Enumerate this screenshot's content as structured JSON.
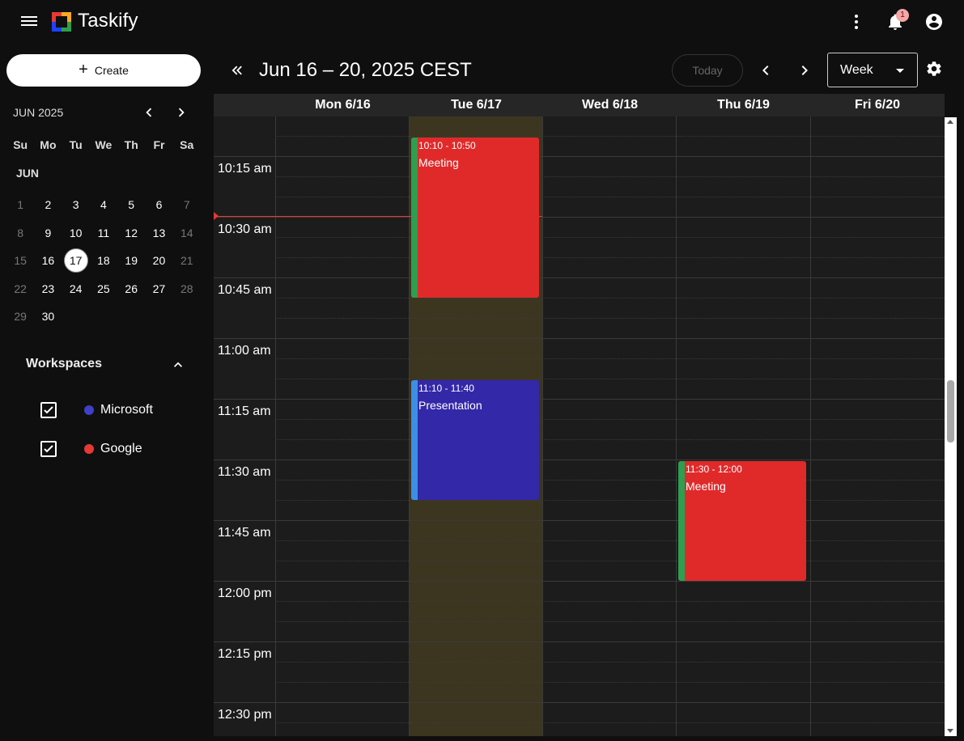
{
  "app": {
    "title": "Taskify"
  },
  "header": {
    "notification_count": "1"
  },
  "sidebar": {
    "create_label": "Create",
    "mini_calendar": {
      "month_title": "JUN 2025",
      "month_label": "JUN",
      "weekdays": [
        "Su",
        "Mo",
        "Tu",
        "We",
        "Th",
        "Fr",
        "Sa"
      ],
      "today": "17",
      "weeks": [
        [
          "1",
          "2",
          "3",
          "4",
          "5",
          "6",
          "7"
        ],
        [
          "8",
          "9",
          "10",
          "11",
          "12",
          "13",
          "14"
        ],
        [
          "15",
          "16",
          "17",
          "18",
          "19",
          "20",
          "21"
        ],
        [
          "22",
          "23",
          "24",
          "25",
          "26",
          "27",
          "28"
        ],
        [
          "29",
          "30",
          "",
          "",
          "",
          "",
          ""
        ]
      ]
    },
    "workspaces": {
      "title": "Workspaces",
      "items": [
        {
          "name": "Microsoft",
          "color": "#3f3fc8",
          "checked": true
        },
        {
          "name": "Google",
          "color": "#e53935",
          "checked": true
        }
      ]
    }
  },
  "calendar": {
    "range_title": "Jun 16 – 20, 2025 CEST",
    "today_label": "Today",
    "view": "Week",
    "days": [
      "Mon 6/16",
      "Tue 6/17",
      "Wed 6/18",
      "Thu 6/19",
      "Fri 6/20"
    ],
    "time_labels": [
      "10:15 am",
      "10:30 am",
      "10:45 am",
      "11:00 am",
      "11:15 am",
      "11:30 am",
      "11:45 am",
      "12:00 pm",
      "12:15 pm",
      "12:30 pm"
    ],
    "events": [
      {
        "day": "Tue 6/17",
        "time": "10:10 - 10:50",
        "title": "Meeting",
        "color": "#e02a2a",
        "bar_color": "#2e9e4f"
      },
      {
        "day": "Tue 6/17",
        "time": "11:10 - 11:40",
        "title": "Presentation",
        "color": "#3328a8",
        "bar_color": "#3d8ee6"
      },
      {
        "day": "Thu 6/19",
        "time": "11:30 - 12:00",
        "title": "Meeting",
        "color": "#e02a2a",
        "bar_color": "#2e9e4f"
      }
    ],
    "current_time": "10:30"
  }
}
